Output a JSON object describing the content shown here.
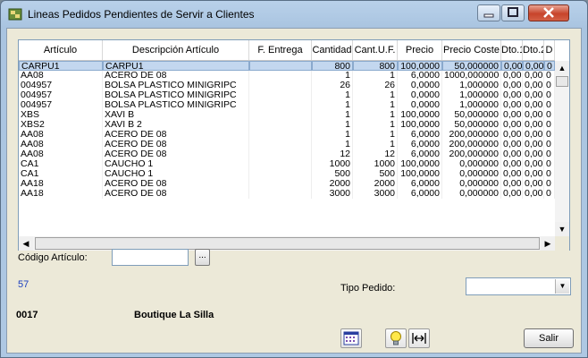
{
  "window": {
    "title": "Lineas Pedidos Pendientes de Servir a Clientes"
  },
  "grid": {
    "columns": [
      "Artículo",
      "Descripción Artículo",
      "F. Entrega",
      "Cantidad",
      "Cant.U.F.",
      "Precio",
      "Precio Coste",
      "Dto.1",
      "Dto.2",
      "D"
    ],
    "rows": [
      [
        "CARPU1",
        "CARPU1",
        "",
        "800",
        "800",
        "100,0000",
        "50,000000",
        "0,00",
        "0,00",
        "0"
      ],
      [
        "AA08",
        "ACERO DE 08",
        "",
        "1",
        "1",
        "6,0000",
        "1000,000000",
        "0,00",
        "0,00",
        "0"
      ],
      [
        "004957",
        "BOLSA PLASTICO MINIGRIPC",
        "",
        "26",
        "26",
        "0,0000",
        "1,000000",
        "0,00",
        "0,00",
        "0"
      ],
      [
        "004957",
        "BOLSA PLASTICO MINIGRIPC",
        "",
        "1",
        "1",
        "0,0000",
        "1,000000",
        "0,00",
        "0,00",
        "0"
      ],
      [
        "004957",
        "BOLSA PLASTICO MINIGRIPC",
        "",
        "1",
        "1",
        "0,0000",
        "1,000000",
        "0,00",
        "0,00",
        "0"
      ],
      [
        "XBS",
        "XAVI B",
        "",
        "1",
        "1",
        "100,0000",
        "50,000000",
        "0,00",
        "0,00",
        "0"
      ],
      [
        "XBS2",
        "XAVI B 2",
        "",
        "1",
        "1",
        "100,0000",
        "50,000000",
        "0,00",
        "0,00",
        "0"
      ],
      [
        "AA08",
        "ACERO DE 08",
        "",
        "1",
        "1",
        "6,0000",
        "200,000000",
        "0,00",
        "0,00",
        "0"
      ],
      [
        "AA08",
        "ACERO DE 08",
        "",
        "1",
        "1",
        "6,0000",
        "200,000000",
        "0,00",
        "0,00",
        "0"
      ],
      [
        "AA08",
        "ACERO DE 08",
        "",
        "12",
        "12",
        "6,0000",
        "200,000000",
        "0,00",
        "0,00",
        "0"
      ],
      [
        "CA1",
        "CAUCHO 1",
        "",
        "1000",
        "1000",
        "100,0000",
        "0,000000",
        "0,00",
        "0,00",
        "0"
      ],
      [
        "CA1",
        "CAUCHO 1",
        "",
        "500",
        "500",
        "100,0000",
        "0,000000",
        "0,00",
        "0,00",
        "0"
      ],
      [
        "AA18",
        "ACERO DE 08",
        "",
        "2000",
        "2000",
        "6,0000",
        "0,000000",
        "0,00",
        "0,00",
        "0"
      ],
      [
        "AA18",
        "ACERO DE 08",
        "",
        "3000",
        "3000",
        "6,0000",
        "0,000000",
        "0,00",
        "0,00",
        "0"
      ]
    ]
  },
  "filters": {
    "codigo_label": "Código Artículo:",
    "codigo_value": "",
    "browse_label": "...",
    "tipo_pedido_label": "Tipo Pedido:",
    "tipo_pedido_value": ""
  },
  "status": {
    "count": "57",
    "client_code": "0017",
    "client_name": "Boutique La Silla"
  },
  "buttons": {
    "salir_label": "Salir"
  },
  "icons": [
    "app-icon",
    "calendar-icon",
    "lightbulb-icon",
    "column-resize-icon"
  ]
}
